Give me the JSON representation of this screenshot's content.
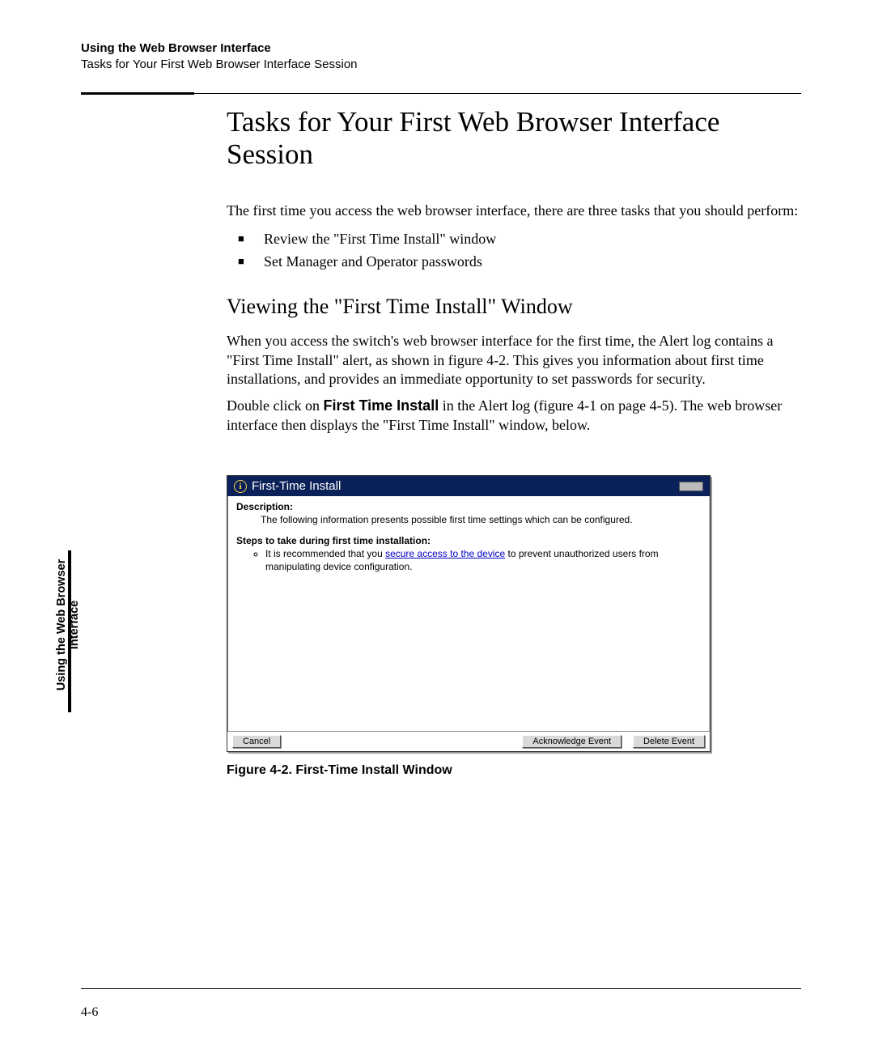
{
  "header": {
    "chapter": "Using the Web Browser Interface",
    "section": "Tasks for Your First Web Browser Interface Session"
  },
  "title": "Tasks for Your First Web Browser Interface Session",
  "intro": "The first time you access the web browser interface, there are three tasks that you should perform:",
  "bullets": [
    "Review the \"First Time Install\" window",
    "Set Manager and Operator passwords"
  ],
  "subheading": "Viewing the \"First Time Install\" Window",
  "para1": "When you access the switch's web browser interface for the first time, the Alert log contains a \"First Time Install\" alert, as shown in figure 4-2. This gives you information about first time installations, and provides an immediate opportunity to set passwords for security.",
  "para2_pre": "Double click on ",
  "para2_bold": "First Time Install",
  "para2_post": " in the Alert log (figure 4-1 on page 4-5). The web browser interface then displays the \"First Time Install\" window, below.",
  "sidetab": {
    "line1": "Using the Web Browser",
    "line2": "Interface"
  },
  "screenshot": {
    "title": "First-Time Install",
    "desc_label": "Description:",
    "desc_text": "The following information presents possible first time settings which can be configured.",
    "steps_label": "Steps to take during first time installation:",
    "step_pre": "It is recommended that you ",
    "step_link": "secure access to the device",
    "step_post": " to prevent unauthorized users from manipulating device configuration.",
    "buttons": {
      "cancel": "Cancel",
      "ack": "Acknowledge Event",
      "del": "Delete Event"
    }
  },
  "figure_caption": "Figure 4-2.   First-Time Install Window",
  "page_number": "4-6"
}
